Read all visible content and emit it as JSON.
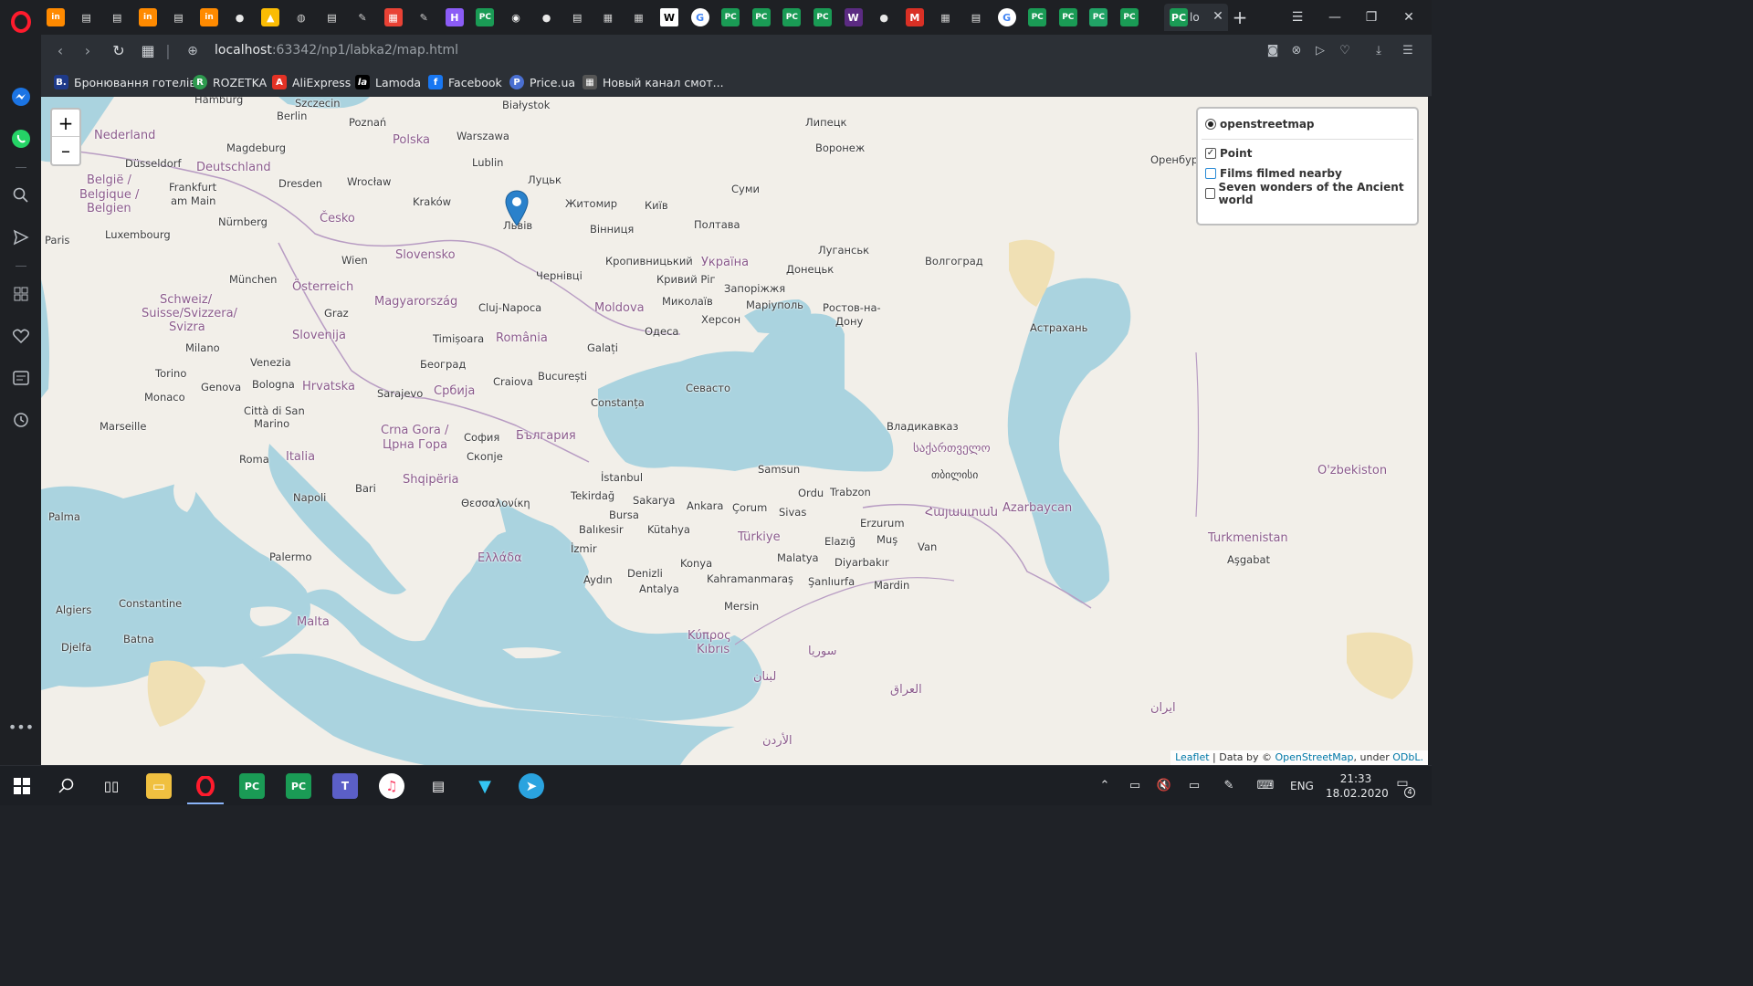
{
  "browser": {
    "active_tab_title": "lo",
    "url_host": "localhost",
    "url_path": ":63342/np1/labka2/map.html",
    "tab_close": "✕",
    "new_tab": "+",
    "window_controls": {
      "menu": "☰",
      "minimize": "—",
      "restore": "❐",
      "close": "✕"
    },
    "tab_icons": [
      "in-logo",
      "doc",
      "doc",
      "in-logo",
      "doc",
      "in-logo",
      "github",
      "google-drive",
      "shield",
      "doc",
      "feather",
      "image",
      "feather",
      "h-app",
      "pycharm",
      "circle-app",
      "github",
      "doc",
      "apps-grid",
      "apps-grid",
      "wikipedia",
      "google",
      "pycharm",
      "pycharm",
      "pycharm",
      "pycharm",
      "w-app",
      "github",
      "gmail",
      "apps-grid",
      "doc",
      "google",
      "pycharm",
      "pycharm",
      "pycharm-green",
      "pycharm"
    ]
  },
  "bookmarks": [
    {
      "label": "Бронювання готелів",
      "icon": "B.",
      "color": "#1e3a8a"
    },
    {
      "label": "ROZETKA",
      "icon": "R",
      "color": "#2e9a4f"
    },
    {
      "label": "AliExpress",
      "icon": "A",
      "color": "#e43225"
    },
    {
      "label": "Lamoda",
      "icon": "la",
      "color": "#000000"
    },
    {
      "label": "Facebook",
      "icon": "f",
      "color": "#1877f2"
    },
    {
      "label": "Price.ua",
      "icon": "P",
      "color": "#4a6fd1"
    },
    {
      "label": "Новый канал смот...",
      "icon": "▦",
      "color": "#555555"
    }
  ],
  "map": {
    "zoom_in": "+",
    "zoom_out": "–",
    "layers": {
      "base": "openstreetmap",
      "overlays": [
        {
          "label": "Point",
          "checked": true
        },
        {
          "label": "Films filmed nearby",
          "checked": false
        },
        {
          "label": "Seven wonders of the Ancient world",
          "checked": false
        }
      ]
    },
    "marker_label": "Point",
    "attribution": {
      "leaflet": "Leaflet",
      "sep": " | Data by © ",
      "osm": "OpenStreetMap",
      "under": ", under ",
      "odbl": "ODbL."
    },
    "labels": {
      "nederland": "Nederland",
      "deutschland": "Deutschland",
      "polska": "Polska",
      "belgie": "België /",
      "belgique": "Belgique /",
      "belgien": "Belgien",
      "luxembourg": "Luxembourg",
      "paris": "Paris",
      "cesko": "Česko",
      "slovensko": "Slovensko",
      "osterreich": "Österreich",
      "magyarorszag": "Magyarország",
      "schweiz": "Schweiz/",
      "suisse": "Suisse/Svizzera/",
      "svizra": "Svizra",
      "slovenija": "Slovenija",
      "hrvatska": "Hrvatska",
      "romania": "România",
      "moldova": "Moldova",
      "ukraina": "Україна",
      "srbija": "Србија",
      "bulgaria": "България",
      "crna_gora": "Crna Gora /",
      "crna_gora2": "Црна Гора",
      "shqiperia": "Shqipëria",
      "italia": "Italia",
      "ellada": "Ελλάδα",
      "turkiye": "Türkiye",
      "kypros": "Κύπρος",
      "kibris": "Kıbrıs",
      "malta": "Malta",
      "sakartvelo": "საქართველო",
      "hayastan": "Հայաստան",
      "azarbaycan": "Azarbaycan",
      "ozbekiston": "O'zbekiston",
      "turkmenistan": "Turkmenistan",
      "iran": "ایران",
      "iraq": "العراق",
      "suriya": "سوريا",
      "lubnan": "لبنان",
      "alurdun": "الأردن",
      "berlin": "Berlin",
      "hamburg": "Hamburg",
      "szczecin": "Szczecin",
      "poznan": "Poznań",
      "warszawa": "Warszawa",
      "bialystok": "Białystok",
      "lublin": "Lublin",
      "dusseldorf": "Düsseldorf",
      "magdeburg": "Magdeburg",
      "frankfurt": "Frankfurt",
      "am_main": "am Main",
      "dresden": "Dresden",
      "wroclaw": "Wrocław",
      "krakow": "Kraków",
      "nurnberg": "Nürnberg",
      "munchen": "München",
      "wien": "Wien",
      "graz": "Graz",
      "milano": "Milano",
      "torino": "Torino",
      "genova": "Genova",
      "venezia": "Venezia",
      "bologna": "Bologna",
      "monaco": "Monaco",
      "marseille": "Marseille",
      "firenze_sm": "Città di San",
      "marino": "Marino",
      "roma": "Roma",
      "napoli": "Napoli",
      "bari": "Bari",
      "palermo": "Palermo",
      "palma": "Palma",
      "algiers": "Algiers",
      "constantine": "Constantine",
      "djelfa": "Djelfa",
      "batna": "Batna",
      "sarajevo": "Sarajevo",
      "beograd": "Београд",
      "timisoara": "Timișoara",
      "cluj": "Cluj-Napoca",
      "craiova": "Craiova",
      "bucuresti": "București",
      "galati": "Galați",
      "constanta": "Constanța",
      "sofia": "София",
      "skopje": "Скопје",
      "thessaloniki": "Θεσσαλονίκη",
      "istanbul": "İstanbul",
      "tekirdag": "Tekirdağ",
      "sakarya": "Sakarya",
      "bursa": "Bursa",
      "balikesir": "Balıkesir",
      "kutahya": "Kütahya",
      "izmir": "İzmir",
      "aydin": "Aydın",
      "denizli": "Denizli",
      "antalya": "Antalya",
      "konya": "Konya",
      "ankara": "Ankara",
      "corum": "Çorum",
      "samsun": "Samsun",
      "ordu": "Ordu",
      "trabzon": "Trabzon",
      "sivas": "Sivas",
      "erzurum": "Erzurum",
      "elazig": "Elazığ",
      "malatya": "Malatya",
      "diyarbakir": "Diyarbakır",
      "mus": "Muş",
      "van": "Van",
      "kahramanmaras": "Kahramanmaraş",
      "sanliurfa": "Şanlıurfa",
      "mardin": "Mardin",
      "mersin": "Mersin",
      "lviv": "Львів",
      "lutsk": "Луцьк",
      "zhytomyr": "Житомир",
      "kyiv": "Київ",
      "vinnytsia": "Вінниця",
      "chernivtsi": "Чернівці",
      "kropyvnytskyi": "Кропивницький",
      "kryvyi_rih": "Кривий Ріг",
      "mykolaiv": "Миколаїв",
      "kherson": "Херсон",
      "odesa": "Одеса",
      "zaporizhzhia": "Запоріжжя",
      "mariupol": "Маріуполь",
      "donetsk": "Донецьк",
      "luhansk": "Луганськ",
      "poltava": "Полтава",
      "sumy": "Суми",
      "sevastopol": "Севасто",
      "rostov": "Ростов-на-",
      "donu": "Дону",
      "volgograd": "Волгоград",
      "astrakhan": "Астрахань",
      "vladikavkaz": "Владикавказ",
      "tbilisi": "თბილისი",
      "lipetsk": "Липецк",
      "voronezh": "Воронеж",
      "orenburg": "Оренбург",
      "ashgabat": "Aşgabat"
    }
  },
  "taskbar": {
    "lang": "ENG",
    "time": "21:33",
    "date": "18.02.2020",
    "notifications": "4",
    "apps": [
      "windows-start",
      "search",
      "task-view",
      "file-explorer",
      "opera",
      "pycharm",
      "pycharm",
      "teams",
      "itunes",
      "film",
      "vpn",
      "telegram"
    ]
  }
}
